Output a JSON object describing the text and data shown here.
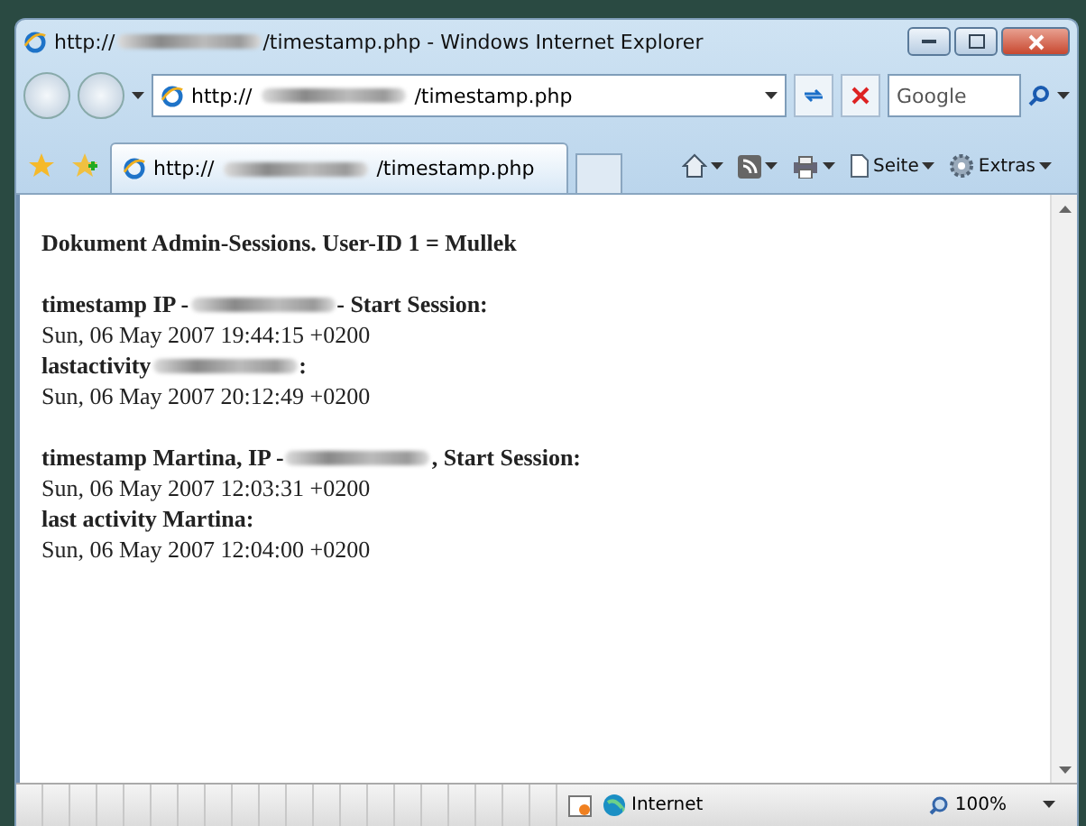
{
  "window": {
    "title": [
      {
        "kind": "text",
        "text": "http://"
      },
      {
        "kind": "redacted"
      },
      {
        "kind": "text",
        "text": "/timestamp.php - Windows Internet Explorer"
      }
    ]
  },
  "address": {
    "parts": [
      {
        "kind": "text",
        "text": "http://"
      },
      {
        "kind": "redacted"
      },
      {
        "kind": "text",
        "text": "/timestamp.php"
      }
    ]
  },
  "search": {
    "placeholder": "Google"
  },
  "tab": {
    "parts": [
      {
        "kind": "text",
        "text": "http://"
      },
      {
        "kind": "redacted"
      },
      {
        "kind": "text",
        "text": "/timestamp.php"
      }
    ],
    "selected": true
  },
  "toolbar": [
    {
      "kind": "home"
    },
    {
      "kind": "feed"
    },
    {
      "kind": "print"
    },
    {
      "kind": "page",
      "label": "Seite"
    },
    {
      "kind": "tools",
      "label": "Extras"
    }
  ],
  "content": [
    {
      "lines": [
        {
          "bold": true,
          "parts": [
            {
              "kind": "text",
              "text": "Dokument  Admin-Sessions. User-ID 1 = Mullek"
            }
          ]
        }
      ]
    },
    {
      "lines": [
        {
          "bold": true,
          "parts": [
            {
              "kind": "text",
              "text": "timestamp IP -"
            },
            {
              "kind": "redacted"
            },
            {
              "kind": "text",
              "text": "- Start Session:"
            }
          ]
        },
        {
          "bold": false,
          "parts": [
            {
              "kind": "text",
              "text": "Sun, 06 May 2007 19:44:15 +0200"
            }
          ]
        },
        {
          "bold": true,
          "parts": [
            {
              "kind": "text",
              "text": "lastactivity "
            },
            {
              "kind": "redacted"
            },
            {
              "kind": "text",
              "text": ":"
            }
          ]
        },
        {
          "bold": false,
          "parts": [
            {
              "kind": "text",
              "text": "Sun, 06 May 2007 20:12:49 +0200"
            }
          ]
        }
      ]
    },
    {
      "lines": [
        {
          "bold": true,
          "parts": [
            {
              "kind": "text",
              "text": "timestamp  Martina, IP - "
            },
            {
              "kind": "redacted"
            },
            {
              "kind": "text",
              "text": ", Start Session:"
            }
          ]
        },
        {
          "bold": false,
          "parts": [
            {
              "kind": "text",
              "text": "Sun, 06 May 2007 12:03:31 +0200"
            }
          ]
        },
        {
          "bold": true,
          "parts": [
            {
              "kind": "text",
              "text": "last activity Martina:"
            }
          ]
        },
        {
          "bold": false,
          "parts": [
            {
              "kind": "text",
              "text": "Sun, 06 May 2007 12:04:00 +0200"
            }
          ]
        }
      ]
    }
  ],
  "status_bar": {
    "zone": "Internet",
    "zoom": "100%"
  }
}
